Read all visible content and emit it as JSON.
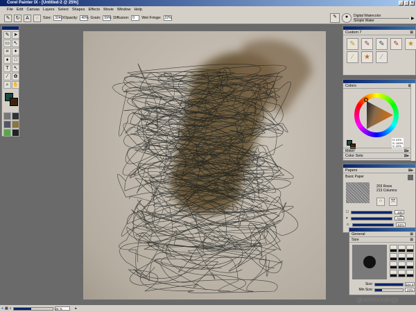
{
  "app": {
    "title": "Corel Painter IX - [Untitled-2 @ 25%]"
  },
  "menu": [
    "File",
    "Edit",
    "Canvas",
    "Layers",
    "Select",
    "Shapes",
    "Effects",
    "Movie",
    "Window",
    "Help"
  ],
  "toolbar": {
    "size_label": "Size:",
    "size": "324.0",
    "opacity_label": "Opacity:",
    "opacity": "40%",
    "grain_label": "Grain:",
    "grain": "59%",
    "diffusion_label": "Diffusion:",
    "diffusion": "0",
    "wet_fringe_label": "Wet Fringe:",
    "wet_fringe": "22%"
  },
  "brush": {
    "category": "Digital Watercolor",
    "variant": "Simple Water"
  },
  "custom_panel": {
    "title": "Custom 7"
  },
  "colors_panel": {
    "title": "Colors",
    "h": "H: 41%",
    "s": "S: 100%",
    "v": "V: 10%",
    "accent_hue": "#c87820",
    "main_color": "#1e4a40",
    "secondary_color": "#3a2510"
  },
  "mixer": {
    "title": "Mixer"
  },
  "color_sets": {
    "title": "Color Sets"
  },
  "papers_panel": {
    "title": "Papers",
    "paper": "Basic Paper",
    "rows": "203 Rows",
    "columns": "213 Columns",
    "scale": "100 %",
    "contrast": "74%",
    "brightness": "51%"
  },
  "general_panel": {
    "title": "General"
  },
  "size_panel": {
    "title": "Size",
    "size_label": "Size:",
    "size": "324.0",
    "min_size_label": "Min Size:",
    "min_size": "23%"
  },
  "status": {
    "zoom": "25 %"
  },
  "watermark": "gnomonology"
}
